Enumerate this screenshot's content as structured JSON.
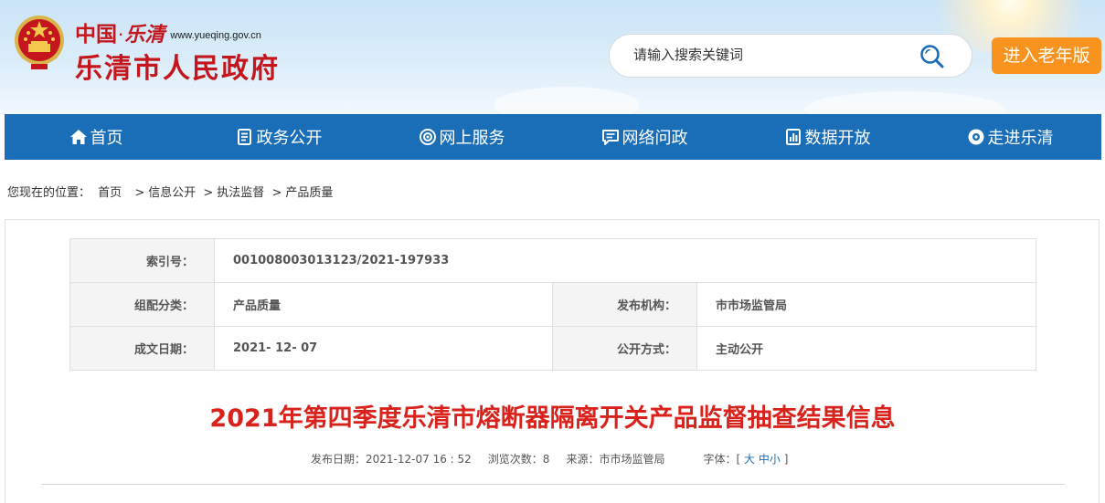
{
  "header": {
    "logo": {
      "country": "中国",
      "dot": "·",
      "city_script": "乐清",
      "url": "www.yueqing.gov.cn",
      "site_name": "乐清市人民政府"
    },
    "search": {
      "placeholder": "请输入搜索关键词",
      "icon": "search-icon"
    },
    "elder_button": "进入老年版"
  },
  "nav": {
    "items": [
      {
        "label": "首页",
        "icon": "home-icon"
      },
      {
        "label": "政务公开",
        "icon": "document-icon"
      },
      {
        "label": "网上服务",
        "icon": "service-icon"
      },
      {
        "label": "网络问政",
        "icon": "chat-icon"
      },
      {
        "label": "数据开放",
        "icon": "data-icon"
      },
      {
        "label": "走进乐清",
        "icon": "eye-icon"
      }
    ]
  },
  "breadcrumb": {
    "prefix": "您现在的位置：",
    "items": [
      "首页",
      "信息公开",
      "执法监督",
      "产品质量"
    ],
    "separator": ">"
  },
  "info": {
    "index_label": "索引号：",
    "index_value": "001008003013123/2021-197933",
    "category_label": "组配分类：",
    "category_value": "产品质量",
    "publisher_label": "发布机构：",
    "publisher_value": "市市场监管局",
    "date_label": "成文日期：",
    "date_value": "2021- 12- 07",
    "mode_label": "公开方式：",
    "mode_value": "主动公开"
  },
  "article": {
    "title": "2021年第四季度乐清市熔断器隔离开关产品监督抽查结果信息",
    "publish_label": "发布日期：",
    "publish_value": "2021-12-07 16 : 52",
    "views_label": "浏览次数：",
    "views_value": "8",
    "source_label": "来源：",
    "source_value": "市市场监管局",
    "font_label": "字体：",
    "font_open": "[",
    "font_large": "大",
    "font_medium": "中",
    "font_small": "小",
    "font_close": "]"
  },
  "colors": {
    "brand_red": "#c4161c",
    "nav_blue": "#1a6eb7",
    "elder_orange": "#f7931e",
    "title_red": "#d9221c"
  }
}
